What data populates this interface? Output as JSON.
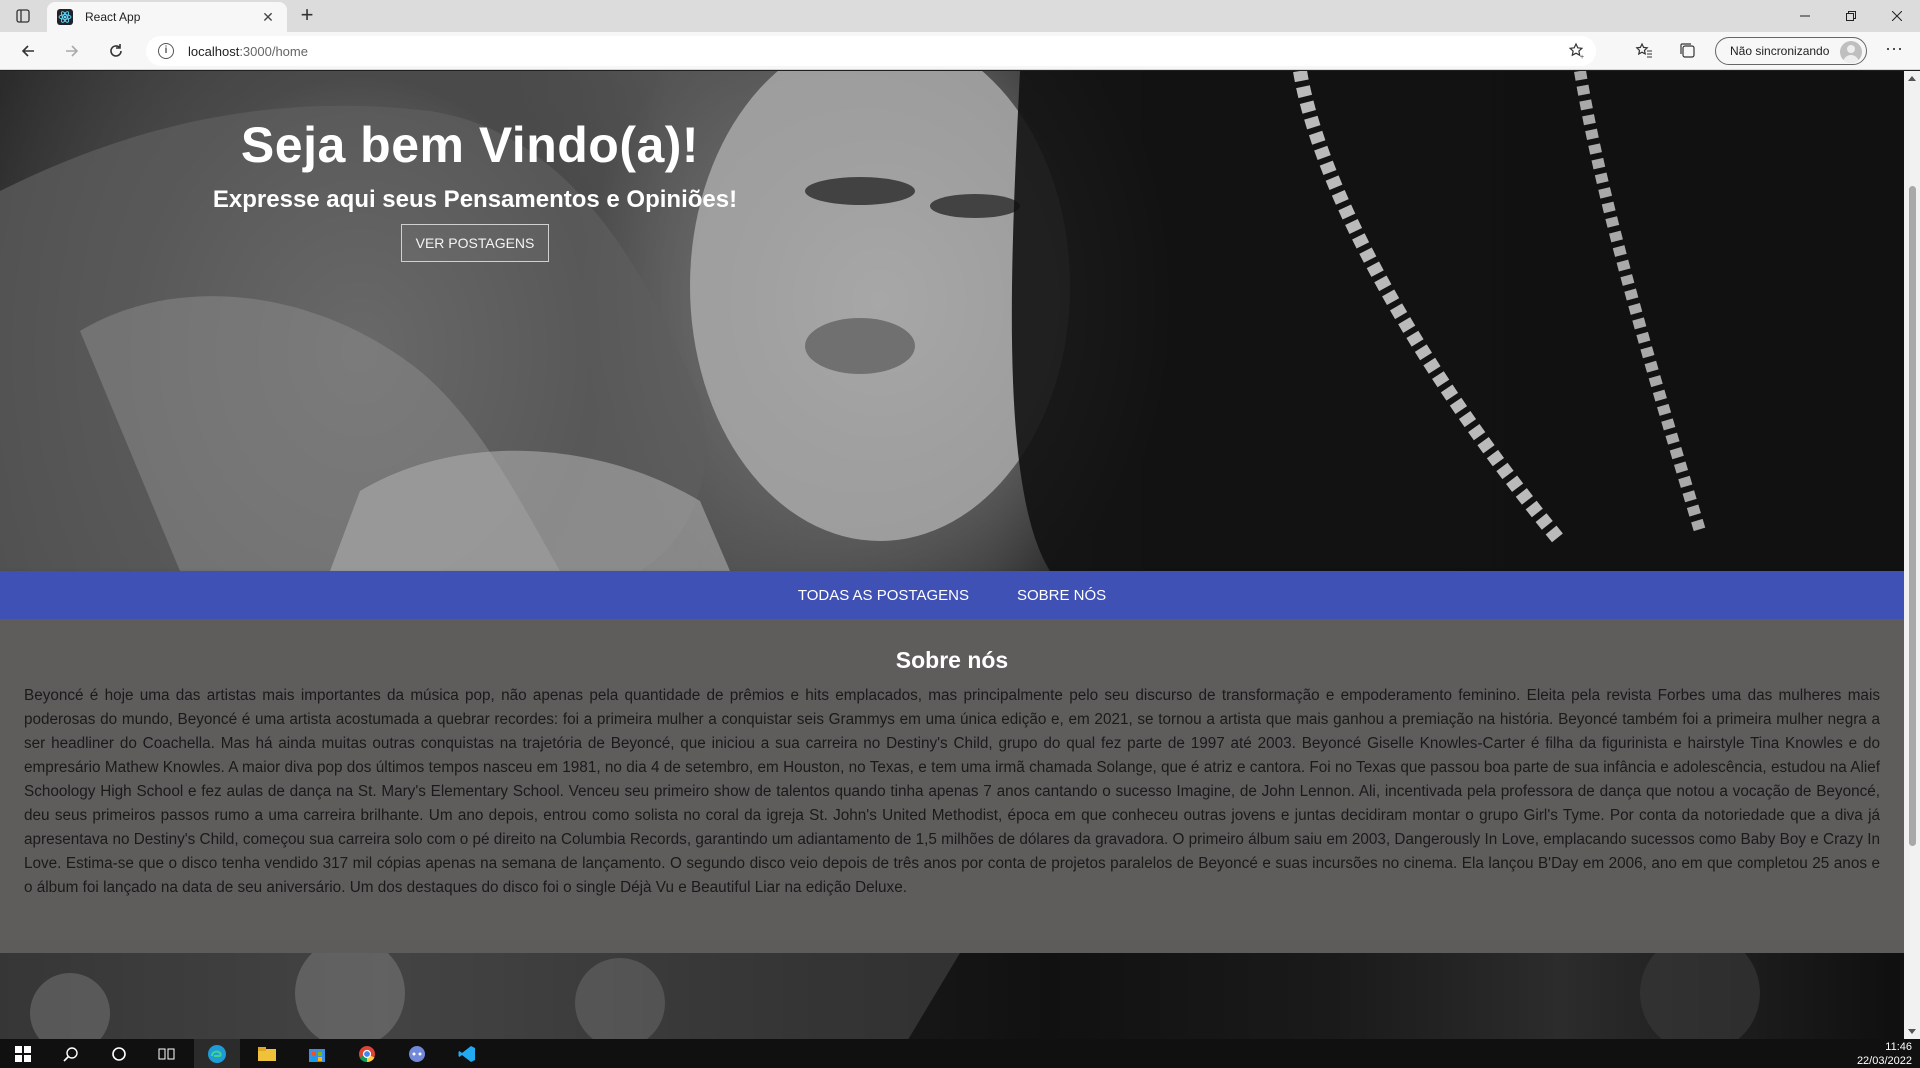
{
  "browser": {
    "tab_title": "React App",
    "url_host": "localhost",
    "url_rest": ":3000/home",
    "profile_label": "Não sincronizando"
  },
  "hero": {
    "title": "Seja bem Vindo(a)!",
    "subtitle": "Expresse aqui seus Pensamentos e Opiniões!",
    "button": "VER POSTAGENS"
  },
  "menu": {
    "items": [
      {
        "label": "TODAS AS POSTAGENS"
      },
      {
        "label": "SOBRE NÓS"
      }
    ]
  },
  "about": {
    "title": "Sobre nós",
    "text": "Beyoncé é hoje uma das artistas mais importantes da música pop, não apenas pela quantidade de prêmios e hits emplacados, mas principalmente pelo seu discurso de transformação e empoderamento feminino. Eleita pela revista Forbes uma das mulheres mais poderosas do mundo, Beyoncé é uma artista acostumada a quebrar recordes: foi a primeira mulher a conquistar seis Grammys em uma única edição e, em 2021, se tornou a artista que mais ganhou a premiação na história. Beyoncé também foi a primeira mulher negra a ser headliner do Coachella. Mas há ainda muitas outras conquistas na trajetória de Beyoncé, que iniciou a sua carreira no Destiny's Child, grupo do qual fez parte de 1997 até 2003. Beyoncé Giselle Knowles-Carter é filha da figurinista e hairstyle Tina Knowles e do empresário Mathew Knowles. A maior diva pop dos últimos tempos nasceu em 1981, no dia 4 de setembro, em Houston, no Texas, e tem uma irmã chamada Solange, que é atriz e cantora. Foi no Texas que passou boa parte de sua infância e adolescência, estudou na Alief Schoology High School e fez aulas de dança na St. Mary's Elementary School. Venceu seu primeiro show de talentos quando tinha apenas 7 anos cantando o sucesso Imagine, de John Lennon. Ali, incentivada pela professora de dança que notou a vocação de Beyoncé, deu seus primeiros passos rumo a uma carreira brilhante. Um ano depois, entrou como solista no coral da igreja St. John's United Methodist, época em que conheceu outras jovens e juntas decidiram montar o grupo Girl's Tyme. Por conta da notoriedade que a diva já apresentava no Destiny's Child, começou sua carreira solo com o pé direito na Columbia Records, garantindo um adiantamento de 1,5 milhões de dólares da gravadora. O primeiro álbum saiu em 2003, Dangerously In Love, emplacando sucessos como Baby Boy e Crazy In Love. Estima-se que o disco tenha vendido 317 mil cópias apenas na semana de lançamento. O segundo disco veio depois de três anos por conta de projetos paralelos de Beyoncé e suas incursões no cinema. Ela lançou B'Day em 2006, ano em que completou 25 anos e o álbum foi lançado na data de seu aniversário. Um dos destaques do disco foi o single Déjà Vu e Beautiful Liar na edição Deluxe."
  },
  "taskbar": {
    "time": "11:46",
    "date": "22/03/2022"
  },
  "colors": {
    "menu_bar": "#3f51b5",
    "about_bg": "#5f5c5c"
  }
}
